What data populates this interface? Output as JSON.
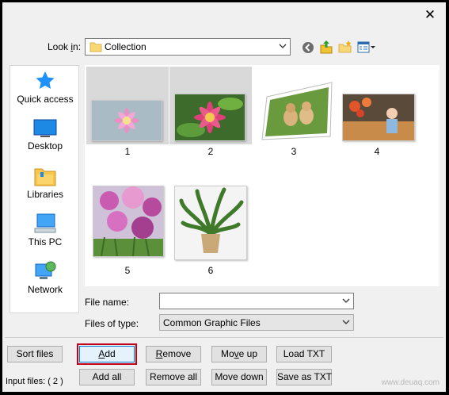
{
  "dialog": {
    "close_glyph": "✕"
  },
  "lookin": {
    "label_pre": "Look ",
    "label_key": "i",
    "label_post": "n:",
    "value": "Collection"
  },
  "places": [
    {
      "label": "Quick access",
      "icon": "star-icon"
    },
    {
      "label": "Desktop",
      "icon": "desktop-icon"
    },
    {
      "label": "Libraries",
      "icon": "libraries-icon"
    },
    {
      "label": "This PC",
      "icon": "computer-icon"
    },
    {
      "label": "Network",
      "icon": "network-icon"
    }
  ],
  "files": [
    {
      "caption": "1",
      "subject": "pink flower on blue background",
      "selected": true
    },
    {
      "caption": "2",
      "subject": "pink dahlia with green leaves",
      "selected": true
    },
    {
      "caption": "3",
      "subject": "two puppies on grass",
      "selected": false
    },
    {
      "caption": "4",
      "subject": "child with flowers",
      "selected": false
    },
    {
      "caption": "5",
      "subject": "purple flower field",
      "selected": false
    },
    {
      "caption": "6",
      "subject": "potted green plant",
      "selected": false
    }
  ],
  "filename": {
    "label": "File name:",
    "value": ""
  },
  "filetype": {
    "label": "Files of type:",
    "value": "Common Graphic Files"
  },
  "buttons": {
    "sort": "Sort files",
    "add_key": "A",
    "add_rest": "dd",
    "remove_key": "R",
    "remove_rest": "emove",
    "moveup_pre": "Mo",
    "moveup_key": "v",
    "moveup_post": "e up",
    "loadtxt": "Load TXT",
    "addall": "Add all",
    "removeall": "Remove all",
    "movedown": "Move down",
    "saveastxt": "Save as TXT"
  },
  "status": {
    "input_files": "Input files: ( 2 )"
  },
  "watermark": "www.deuaq.com"
}
